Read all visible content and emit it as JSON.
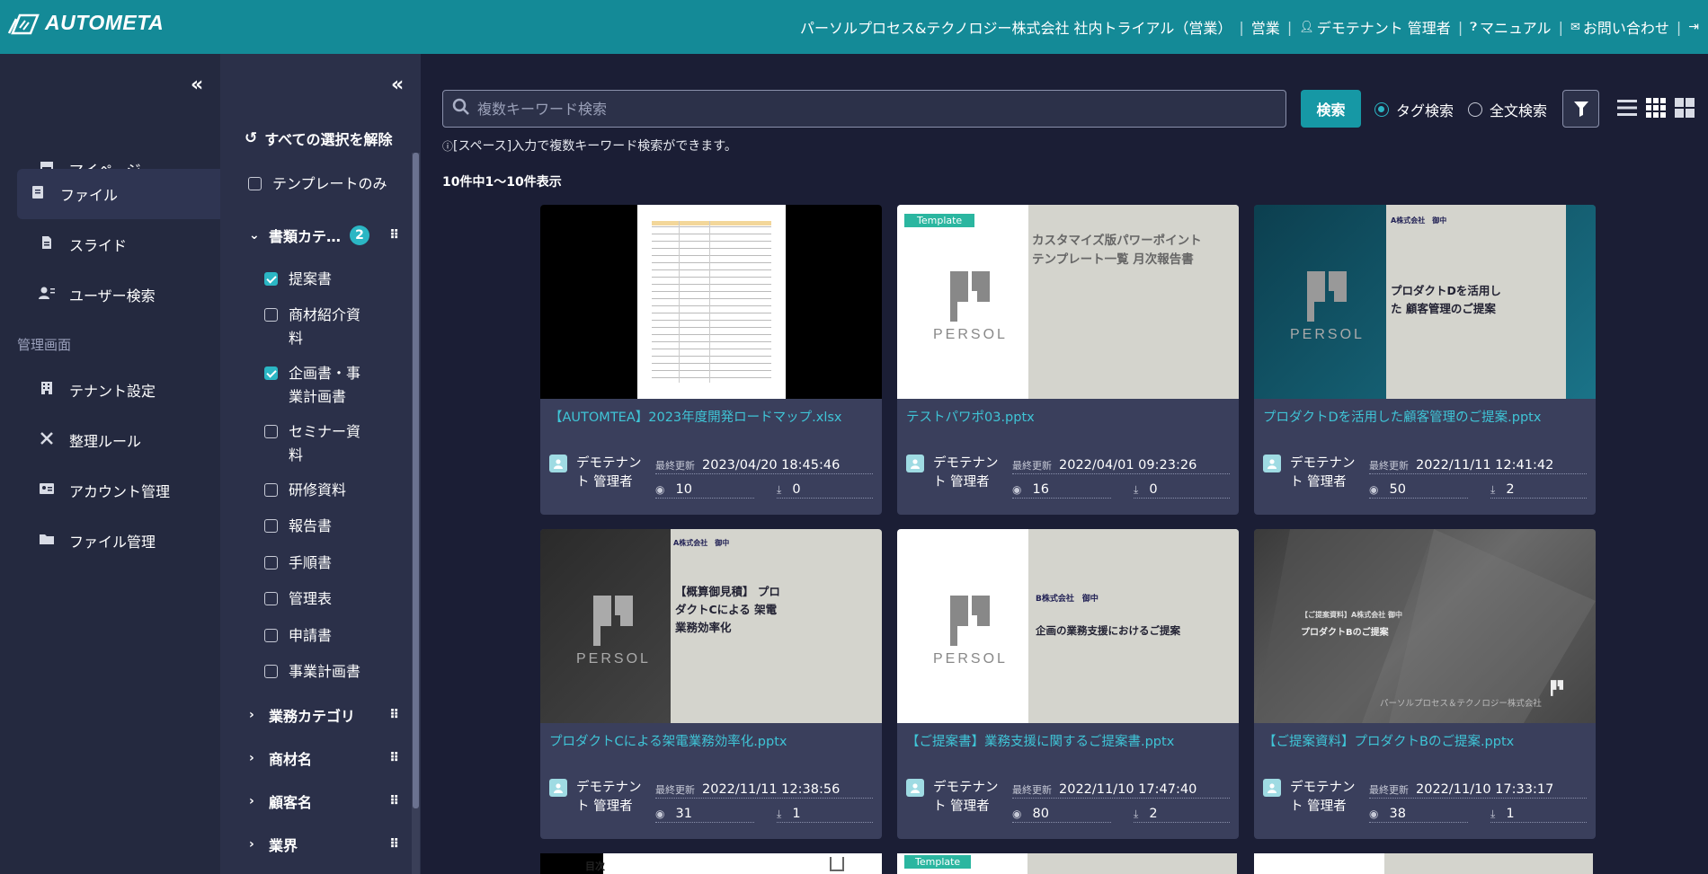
{
  "app": {
    "logo_text": "AUTOMETA"
  },
  "header": {
    "tenant": "パーソルプロセス&テクノロジー株式会社 社内トライアル（営業）",
    "dept": "営業",
    "user": "デモテナント 管理者",
    "manual": "マニュアル",
    "contact": "お問い合わせ"
  },
  "sidebar": {
    "items": [
      {
        "label": "マイページ",
        "icon": "store-icon"
      },
      {
        "label": "ファイル",
        "icon": "file-icon"
      },
      {
        "label": "スライド",
        "icon": "document-icon"
      },
      {
        "label": "ユーザー検索",
        "icon": "user-search-icon"
      }
    ],
    "admin_label": "管理画面",
    "admin_items": [
      {
        "label": "テナント設定",
        "icon": "building-icon"
      },
      {
        "label": "整理ルール",
        "icon": "tools-icon"
      },
      {
        "label": "アカウント管理",
        "icon": "id-card-icon"
      },
      {
        "label": "ファイル管理",
        "icon": "folder-icon"
      }
    ]
  },
  "filter": {
    "clear_all": "すべての選択を解除",
    "template_only": "テンプレートのみ",
    "doc_category": "書類カテ…",
    "doc_category_count": "2",
    "options": [
      {
        "label": "提案書",
        "checked": true
      },
      {
        "label": "商材紹介資料",
        "checked": false
      },
      {
        "label": "企画書・事業計画書",
        "checked": true
      },
      {
        "label": "セミナー資料",
        "checked": false
      },
      {
        "label": "研修資料",
        "checked": false
      },
      {
        "label": "報告書",
        "checked": false
      },
      {
        "label": "手順書",
        "checked": false
      },
      {
        "label": "管理表",
        "checked": false
      },
      {
        "label": "申請書",
        "checked": false
      },
      {
        "label": "事業計画書",
        "checked": false
      }
    ],
    "categories": [
      "業務カテゴリ",
      "商材名",
      "顧客名",
      "業界"
    ]
  },
  "search": {
    "placeholder": "複数キーワード検索",
    "button": "検索",
    "tag_search": "タグ検索",
    "full_text": "全文検索",
    "hint": "[スペース]入力で複数キーワード検索ができます。",
    "result_count": "10件中1〜10件表示"
  },
  "cards": [
    {
      "title": "【AUTOMTEA】2023年度開発ロードマップ.xlsx",
      "owner": "デモテナント 管理者",
      "updated_label": "最終更新",
      "updated": "2023/04/20 18:45:46",
      "views": "10",
      "downloads": "0"
    },
    {
      "title": "テストパワポ03.pptx",
      "owner": "デモテナント 管理者",
      "updated_label": "最終更新",
      "updated": "2022/04/01 09:23:26",
      "views": "16",
      "downloads": "0",
      "tag": "Template",
      "slide_text": "カスタマイズ版パワーポイント テンプレート一覧 月次報告書",
      "brand": "PERSOL"
    },
    {
      "title": "プロダクトDを活用した顧客管理のご提案.pptx",
      "owner": "デモテナント 管理者",
      "updated_label": "最終更新",
      "updated": "2022/11/11 12:41:42",
      "views": "50",
      "downloads": "2",
      "slide_to": "A株式会社　御中",
      "slide_text": "プロダクトDを活用した 顧客管理のご提案",
      "brand": "PERSOL"
    },
    {
      "title": "プロダクトCによる架電業務効率化.pptx",
      "owner": "デモテナント 管理者",
      "updated_label": "最終更新",
      "updated": "2022/11/11 12:38:56",
      "views": "31",
      "downloads": "1",
      "slide_to": "A株式会社　御中",
      "slide_text": "【概算御見積】 プロダクトCによる 架電業務効率化",
      "brand": "PERSOL"
    },
    {
      "title": "【ご提案書】業務支援に関するご提案書.pptx",
      "owner": "デモテナント 管理者",
      "updated_label": "最終更新",
      "updated": "2022/11/10 17:47:40",
      "views": "80",
      "downloads": "2",
      "slide_to": "B株式会社　御中",
      "slide_text": "企画の業務支援におけるご提案",
      "brand": "PERSOL"
    },
    {
      "title": "【ご提案資料】プロダクトBのご提案.pptx",
      "owner": "デモテナント 管理者",
      "updated_label": "最終更新",
      "updated": "2022/11/10 17:33:17",
      "views": "38",
      "downloads": "1",
      "slide_to": "【ご提案資料】A株式会社 御中",
      "slide_text": "プロダクトBのご提案",
      "slide_footer": "パーソルプロセス＆テクノロジー株式会社"
    }
  ],
  "partial_row": {
    "toc": "目次",
    "tag": "Template"
  },
  "colors": {
    "header": "#148a97",
    "accent": "#2bb6c4",
    "link": "#3fc4d6",
    "bg": "#1b1e35",
    "card": "#3a3f5c"
  }
}
